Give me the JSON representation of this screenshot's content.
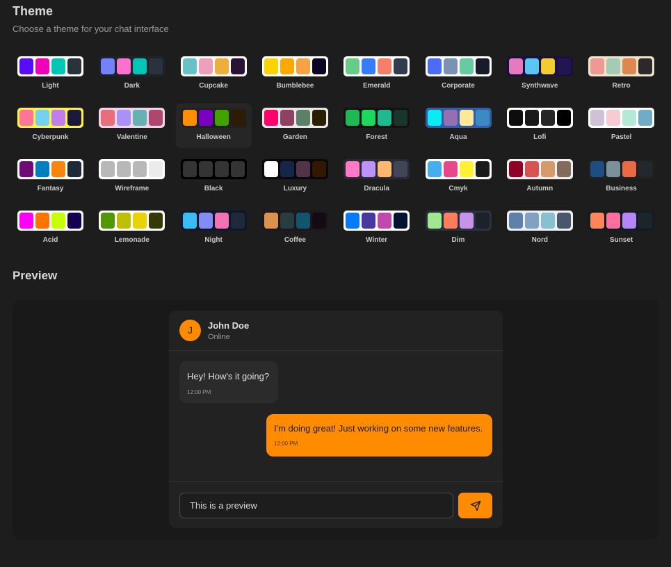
{
  "header": {
    "title": "Theme",
    "subtitle": "Choose a theme for your chat interface"
  },
  "themes": [
    {
      "name": "Light",
      "bg": "#ffffff",
      "colors": [
        "#570df8",
        "#f000b8",
        "#00c7b5",
        "#2a323c"
      ]
    },
    {
      "name": "Dark",
      "bg": "#1d232a",
      "colors": [
        "#7582ff",
        "#ff71cf",
        "#00c7b5",
        "#2a323c"
      ]
    },
    {
      "name": "Cupcake",
      "bg": "#faf7f5",
      "colors": [
        "#65c3c8",
        "#ef9fbc",
        "#eeaf3a",
        "#291334"
      ]
    },
    {
      "name": "Bumblebee",
      "bg": "#ffffff",
      "colors": [
        "#fad300",
        "#ffa800",
        "#f9a243",
        "#0d0424"
      ]
    },
    {
      "name": "Emerald",
      "bg": "#ffffff",
      "colors": [
        "#66cc8a",
        "#377cfb",
        "#f68067",
        "#333c4d"
      ]
    },
    {
      "name": "Corporate",
      "bg": "#ffffff",
      "colors": [
        "#4b6bfb",
        "#7b92b2",
        "#67cba0",
        "#181a2a"
      ]
    },
    {
      "name": "Synthwave",
      "bg": "#1a103d",
      "colors": [
        "#e779c1",
        "#58c7f3",
        "#f3cc30",
        "#221551"
      ]
    },
    {
      "name": "Retro",
      "bg": "#ece3ca",
      "colors": [
        "#ef9995",
        "#a4cbb4",
        "#dc8850",
        "#2e282a"
      ]
    },
    {
      "name": "Cyberpunk",
      "bg": "#fff248",
      "colors": [
        "#ff7598",
        "#75d1f0",
        "#c07eec",
        "#1b1a3a"
      ]
    },
    {
      "name": "Valentine",
      "bg": "#f0d6e8",
      "colors": [
        "#e96d7b",
        "#a991f7",
        "#66b1b3",
        "#af4670"
      ]
    },
    {
      "name": "Halloween",
      "bg": "#212121",
      "colors": [
        "#ff8f00",
        "#7a00c4",
        "#42a300",
        "#2f1b05"
      ]
    },
    {
      "name": "Garden",
      "bg": "#e9e7e7",
      "colors": [
        "#ff006d",
        "#8e4162",
        "#5c7f67",
        "#291e00"
      ]
    },
    {
      "name": "Forest",
      "bg": "#171212",
      "colors": [
        "#1eb854",
        "#1fd65f",
        "#1db990",
        "#19362d"
      ]
    },
    {
      "name": "Aqua",
      "bg": "#345da7",
      "colors": [
        "#09ecf3",
        "#966fb3",
        "#ffe999",
        "#3b8ac4"
      ]
    },
    {
      "name": "Lofi",
      "bg": "#ffffff",
      "colors": [
        "#0d0d0d",
        "#1a1919",
        "#262626",
        "#000000"
      ]
    },
    {
      "name": "Pastel",
      "bg": "#ffffff",
      "colors": [
        "#d1c1d7",
        "#f6cbd1",
        "#b4e9d6",
        "#70acc7"
      ]
    },
    {
      "name": "Fantasy",
      "bg": "#ffffff",
      "colors": [
        "#6e0b75",
        "#007ebd",
        "#f8860d",
        "#1f2937"
      ]
    },
    {
      "name": "Wireframe",
      "bg": "#ffffff",
      "colors": [
        "#b8b8b8",
        "#b8b8b8",
        "#b8b8b8",
        "#ebebeb"
      ]
    },
    {
      "name": "Black",
      "bg": "#000000",
      "colors": [
        "#343434",
        "#343434",
        "#343434",
        "#343434"
      ]
    },
    {
      "name": "Luxury",
      "bg": "#09090b",
      "colors": [
        "#ffffff",
        "#152747",
        "#513448",
        "#331800"
      ]
    },
    {
      "name": "Dracula",
      "bg": "#282a36",
      "colors": [
        "#ff79c6",
        "#bd93f9",
        "#ffb86c",
        "#414558"
      ]
    },
    {
      "name": "Cmyk",
      "bg": "#ffffff",
      "colors": [
        "#45aeee",
        "#e8488a",
        "#fff232",
        "#1a1a1a"
      ]
    },
    {
      "name": "Autumn",
      "bg": "#f1f1f1",
      "colors": [
        "#8c0327",
        "#d85251",
        "#d59b6a",
        "#826a5c"
      ]
    },
    {
      "name": "Business",
      "bg": "#202020",
      "colors": [
        "#1c4e80",
        "#7c909a",
        "#ea6947",
        "#23282e"
      ]
    },
    {
      "name": "Acid",
      "bg": "#fafafa",
      "colors": [
        "#ff00f4",
        "#ff7400",
        "#c8ff00",
        "#140152"
      ]
    },
    {
      "name": "Lemonade",
      "bg": "#ffffff",
      "colors": [
        "#519903",
        "#bdc000",
        "#e9d302",
        "#373a00"
      ]
    },
    {
      "name": "Night",
      "bg": "#0f172a",
      "colors": [
        "#38bdf8",
        "#818cf8",
        "#f471b5",
        "#1e293b"
      ]
    },
    {
      "name": "Coffee",
      "bg": "#20161f",
      "colors": [
        "#db924b",
        "#263e3f",
        "#10576d",
        "#120c12"
      ]
    },
    {
      "name": "Winter",
      "bg": "#ffffff",
      "colors": [
        "#047aff",
        "#463aa2",
        "#c148ac",
        "#021431"
      ]
    },
    {
      "name": "Dim",
      "bg": "#2a303c",
      "colors": [
        "#9fe88d",
        "#ff7d5c",
        "#c792e9",
        "#1c212b"
      ]
    },
    {
      "name": "Nord",
      "bg": "#eceff4",
      "colors": [
        "#5e81ac",
        "#81a1c1",
        "#88c0d0",
        "#4c566a"
      ]
    },
    {
      "name": "Sunset",
      "bg": "#121c22",
      "colors": [
        "#ff865b",
        "#fd6f9c",
        "#b387fa",
        "#1b262c"
      ]
    }
  ],
  "selected_theme": "Halloween",
  "preview": {
    "title": "Preview",
    "contact": {
      "initial": "J",
      "name": "John Doe",
      "status": "Online"
    },
    "messages": [
      {
        "text": "Hey! How's it going?",
        "time": "12:00 PM",
        "sent": false
      },
      {
        "text": "I'm doing great! Just working on some new features.",
        "time": "12:00 PM",
        "sent": true
      }
    ],
    "input_value": "This is a preview",
    "send_icon": "paper-plane-icon"
  },
  "colors": {
    "accent": "#ff8c00",
    "background": "#1d1d1d"
  }
}
